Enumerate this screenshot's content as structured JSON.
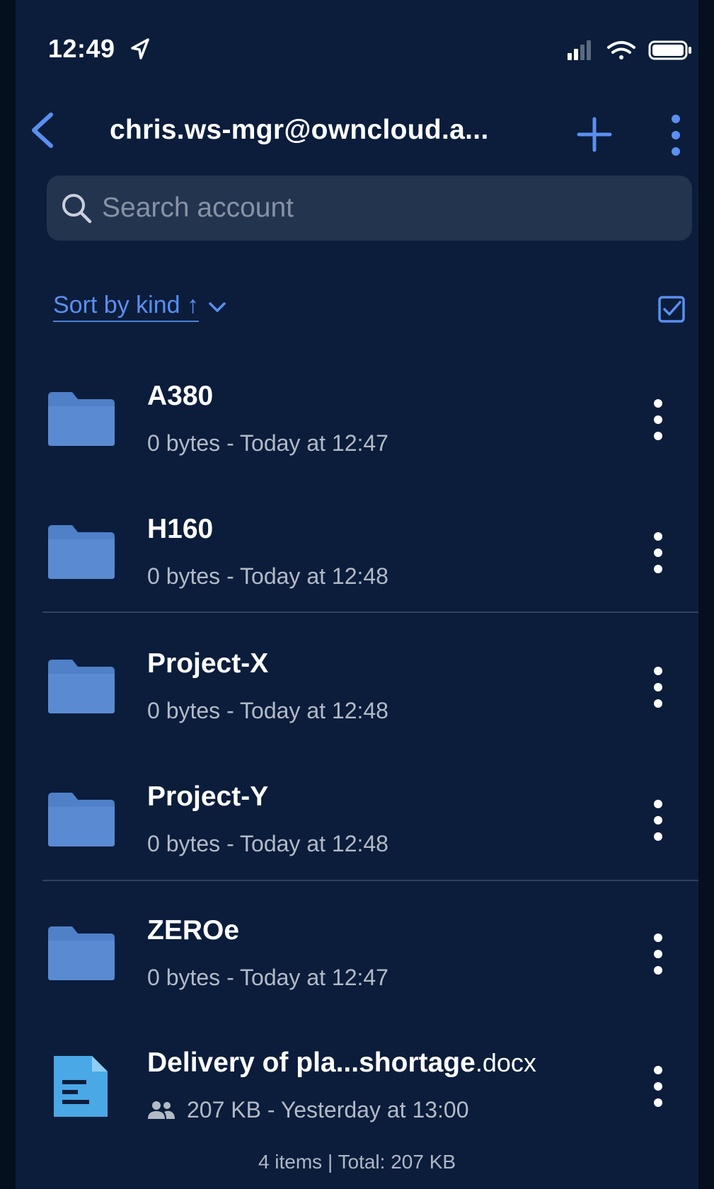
{
  "status_bar": {
    "time": "12:49",
    "location_icon": "location-arrow-icon",
    "signal_icon": "cellular-signal-icon",
    "wifi_icon": "wifi-icon",
    "battery_icon": "battery-icon"
  },
  "nav": {
    "title": "chris.ws-mgr@owncloud.a...",
    "back_icon": "chevron-left-icon",
    "add_icon": "plus-icon",
    "more_icon": "vertical-ellipsis-icon"
  },
  "search": {
    "placeholder": "Search account",
    "value": ""
  },
  "sort": {
    "label": "Sort by kind",
    "direction_icon": "arrow-up",
    "direction_glyph": "↑"
  },
  "items": [
    {
      "name": "A380",
      "extension": "",
      "size": "0 bytes",
      "date": "Today at 12:47",
      "meta": "0 bytes - Today at 12:47",
      "kind": "folder",
      "shared": false
    },
    {
      "name": "H160",
      "extension": "",
      "size": "0 bytes",
      "date": "Today at 12:48",
      "meta": "0 bytes - Today at 12:48",
      "kind": "folder",
      "shared": false
    },
    {
      "name": "Project-X",
      "extension": "",
      "size": "0 bytes",
      "date": "Today at 12:48",
      "meta": "0 bytes - Today at 12:48",
      "kind": "folder",
      "shared": false
    },
    {
      "name": "Project-Y",
      "extension": "",
      "size": "0 bytes",
      "date": "Today at 12:48",
      "meta": "0 bytes - Today at 12:48",
      "kind": "folder",
      "shared": false
    },
    {
      "name": "ZEROe",
      "extension": "",
      "size": "0 bytes",
      "date": "Today at 12:47",
      "meta": "0 bytes - Today at 12:47",
      "kind": "folder",
      "shared": false
    },
    {
      "name": "Delivery of pla...shortage",
      "extension": ".docx",
      "size": "207 KB",
      "date": "Yesterday at 13:00",
      "meta": "207 KB - Yesterday at 13:00",
      "kind": "document",
      "shared": true
    }
  ],
  "footer": {
    "summary": "4 items | Total: 207 KB"
  },
  "colors": {
    "background": "#0b1d3b",
    "accent": "#5b8ff0",
    "folder": "#4f80c8",
    "document": "#4aa8e6",
    "secondary_text": "#b3bac6"
  }
}
